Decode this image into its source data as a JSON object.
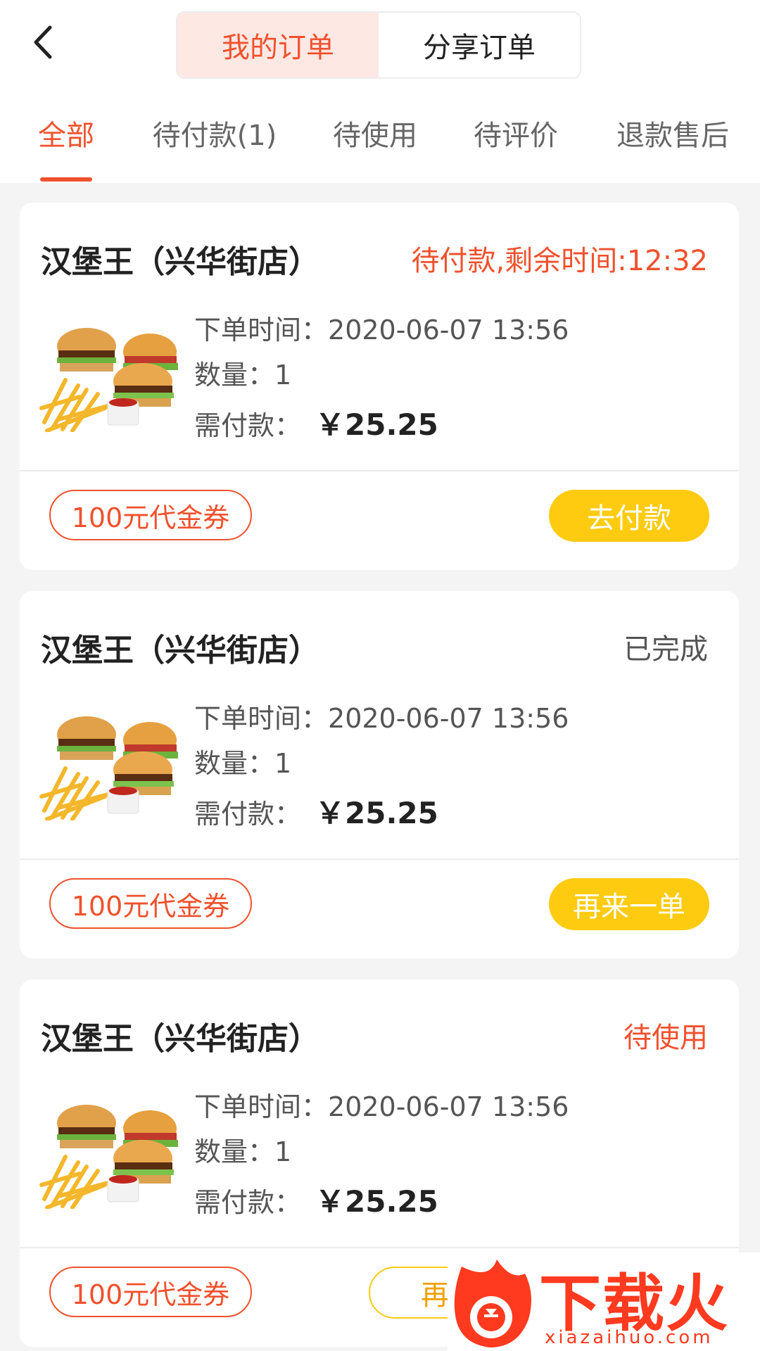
{
  "header": {
    "back_icon": "chevron-left-icon",
    "segments": [
      "我的订单",
      "分享订单"
    ],
    "active_segment": 0
  },
  "tabs": {
    "items": [
      "全部",
      "待付款(1)",
      "待使用",
      "待评价",
      "退款售后"
    ],
    "active": 0
  },
  "colors": {
    "accent": "#f0512d",
    "button_yellow": "#fecb10",
    "background": "#f4f4f4"
  },
  "orders": [
    {
      "shop": "汉堡王（兴华街店）",
      "status": "待付款,剩余时间:12:32",
      "time_label": "下单时间：",
      "time_value": "2020-06-07 13:56",
      "qty_label": "数量：",
      "qty_value": "1",
      "pay_label": "需付款：",
      "price": "￥25.25",
      "coupon": "100元代金券",
      "action": "去付款"
    },
    {
      "shop": "汉堡王（兴华街店）",
      "status": "已完成",
      "time_label": "下单时间：",
      "time_value": "2020-06-07 13:56",
      "qty_label": "数量：",
      "qty_value": "1",
      "pay_label": "需付款：",
      "price": "￥25.25",
      "coupon": "100元代金券",
      "action": "再来一单"
    },
    {
      "shop": "汉堡王（兴华街店）",
      "status": "待使用",
      "time_label": "下单时间：",
      "time_value": "2020-06-07 13:56",
      "qty_label": "数量：",
      "qty_value": "1",
      "pay_label": "需付款：",
      "price": "￥25.25",
      "coupon": "100元代金券",
      "action": "再来"
    }
  ],
  "watermark": {
    "text": "下载火",
    "url": "xiazaihuo.com"
  }
}
